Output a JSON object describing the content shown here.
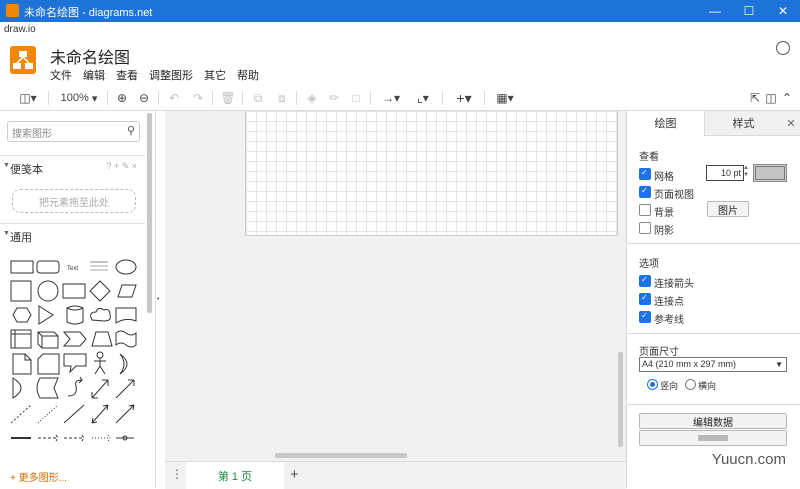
{
  "window": {
    "title": "未命名绘图 - diagrams.net"
  },
  "url_label": "draw.io",
  "header": {
    "title": "未命名绘图",
    "menu": [
      "文件",
      "编辑",
      "查看",
      "调整图形",
      "其它",
      "帮助"
    ]
  },
  "toolbar": {
    "zoom": "100%"
  },
  "sidebar": {
    "search_placeholder": "搜索图形",
    "scratchpad_title": "便笺本",
    "scratchpad_actions": "? + ✎ ×",
    "drop_hint": "把元素拖至此处",
    "general_title": "通用",
    "text_shape": "Text",
    "more_shapes": "+ 更多图形..."
  },
  "bottom": {
    "page_tab": "第 1 页",
    "add_page": "+"
  },
  "panel": {
    "tabs": [
      "绘图",
      "样式"
    ],
    "view_title": "查看",
    "grid_label": "网格",
    "grid_size": "10 pt",
    "page_view_label": "页面视图",
    "background_label": "背景",
    "image_button": "图片",
    "shadow_label": "阴影",
    "options_title": "选项",
    "connection_arrows": "连接箭头",
    "connection_points": "连接点",
    "guides": "参考线",
    "paper_title": "页面尺寸",
    "paper_size": "A4 (210 mm x 297 mm)",
    "portrait": "竖向",
    "landscape": "横向",
    "edit_data_button": "编辑数据"
  },
  "watermark": "Yuucn.com",
  "colors": {
    "titlebar": "#1e73d6",
    "logo": "#f08705",
    "check": "#1a73e8",
    "page_tab_text": "#1c8a3c"
  }
}
